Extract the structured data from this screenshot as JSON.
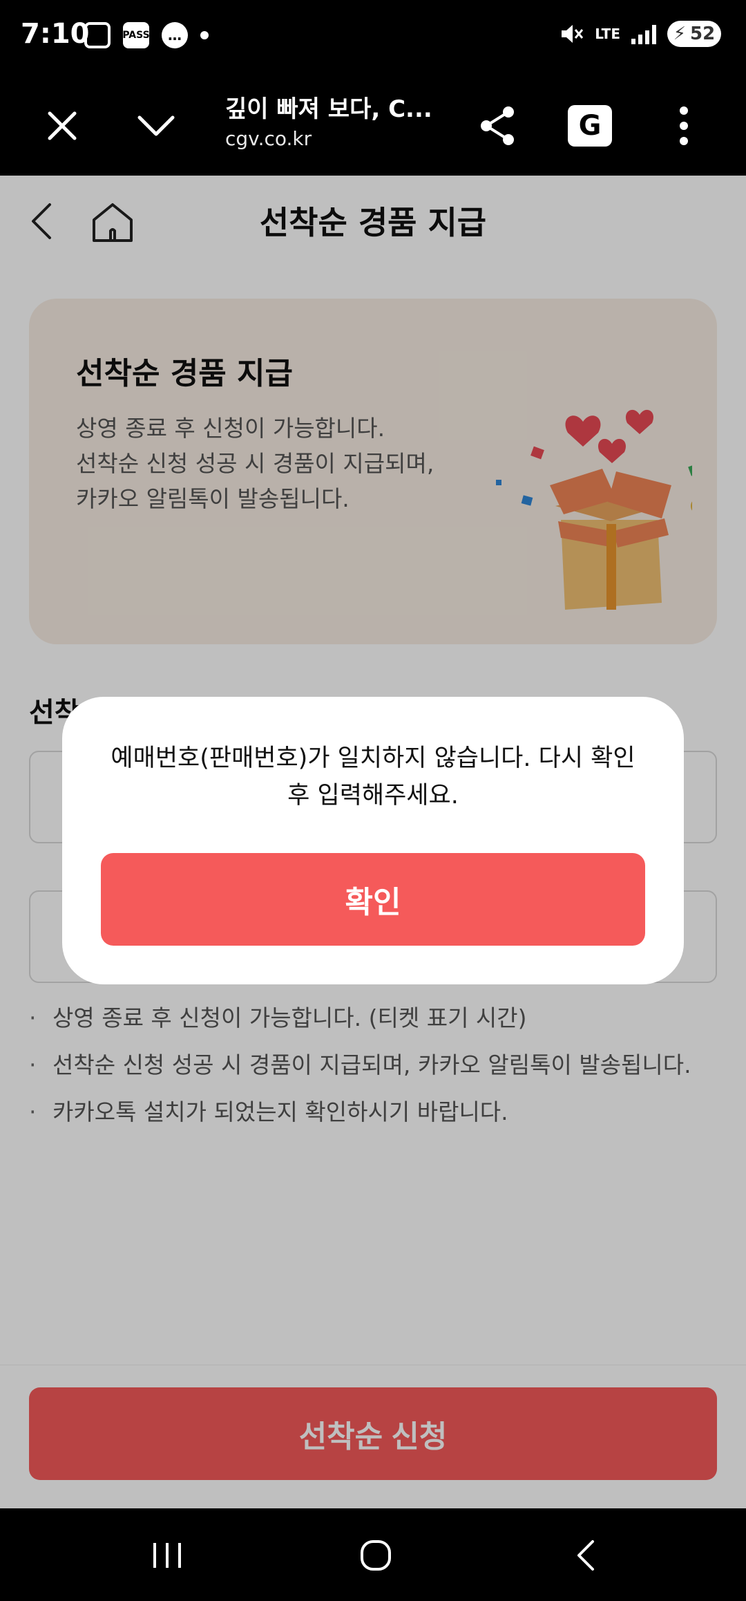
{
  "status_bar": {
    "time": "7:10",
    "pass_label": "PASS",
    "lte_label": "LTE",
    "battery": "52"
  },
  "browser": {
    "page_title": "깊이 빠져 보다, C...",
    "url": "cgv.co.kr",
    "translate_label": "G"
  },
  "header": {
    "title": "선착순 경품 지급"
  },
  "promo": {
    "title": "선착순 경품 지급",
    "lines": [
      "상영 종료 후 신청이 가능합니다.",
      "선착순 신청 성공 시 경품이 지급되며,",
      "카카오 알림톡이 발송됩니다."
    ]
  },
  "form": {
    "section_label": "선착"
  },
  "notes": [
    "상영 종료 후 신청이 가능합니다. (티켓 표기 시간)",
    "선착순 신청 성공 시 경품이 지급되며, 카카오 알림톡이 발송됩니다.",
    "카카오톡 설치가 되었는지 확인하시기 바랍니다."
  ],
  "bottom": {
    "apply_label": "선착순 신청"
  },
  "modal": {
    "message_line1": "예매번호(판매번호)가 일치하지 않습니다. 다시 확인",
    "message_line2": "후 입력해주세요.",
    "confirm_label": "확인"
  },
  "colors": {
    "accent": "#f55a5a",
    "promo_bg": "#f7ede3",
    "overlay": "rgba(0,0,0,0.25)"
  },
  "icons": {
    "close": "close-icon",
    "collapse": "chevron-down-icon",
    "share": "share-icon",
    "translate": "translate-icon",
    "more": "more-vertical-icon",
    "back": "back-arrow-icon",
    "home": "home-icon",
    "gift": "gift-box-illustration"
  }
}
